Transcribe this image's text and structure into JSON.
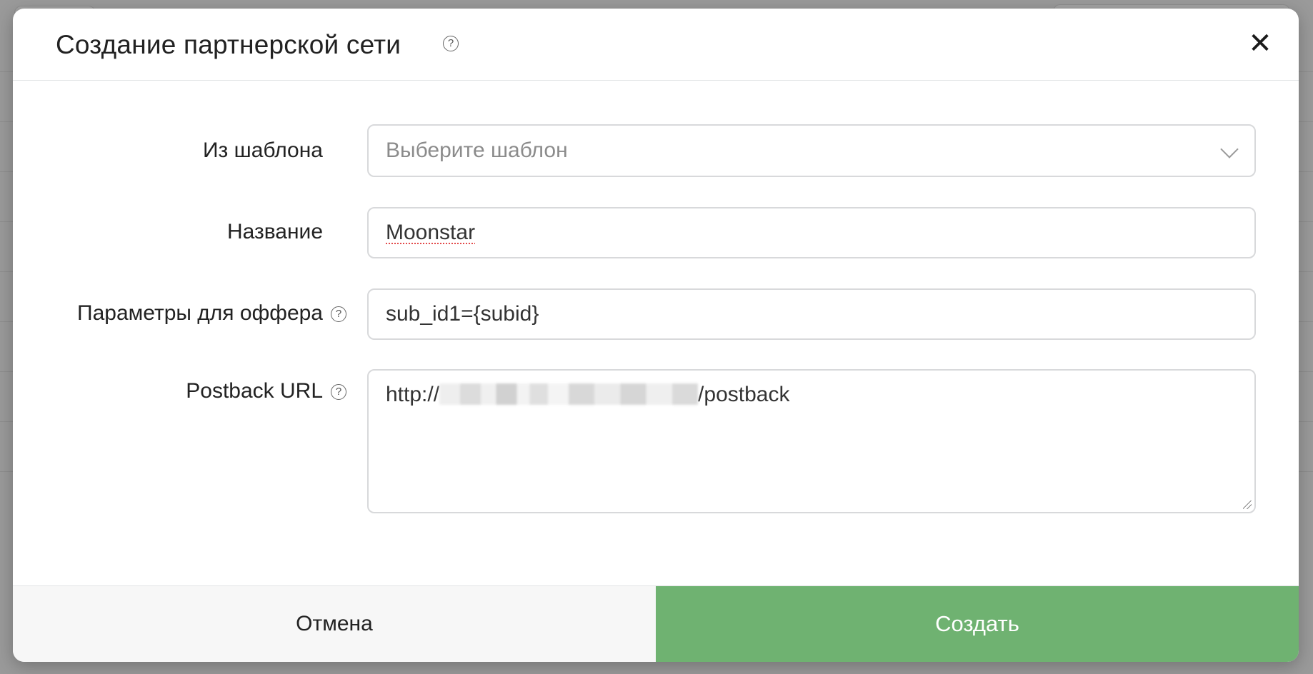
{
  "modal": {
    "title": "Создание партнерской сети",
    "close_symbol": "✕",
    "help_symbol": "?"
  },
  "form": {
    "template": {
      "label": "Из шаблона",
      "placeholder": "Выберите шаблон"
    },
    "name": {
      "label": "Название",
      "value": "Moonstar"
    },
    "offer_params": {
      "label": "Параметры для оффера",
      "value": "sub_id1={subid}"
    },
    "postback": {
      "label": "Postback URL",
      "prefix": "http://",
      "suffix": "/postback"
    }
  },
  "footer": {
    "cancel_label": "Отмена",
    "create_label": "Создать"
  },
  "colors": {
    "create_button": "#6fb271",
    "cancel_button": "#f7f7f7"
  }
}
